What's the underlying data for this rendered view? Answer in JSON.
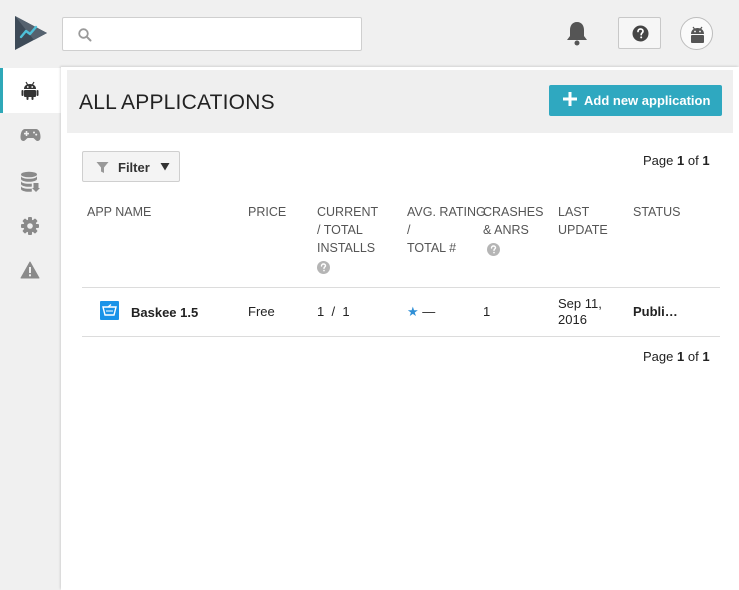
{
  "search": {
    "placeholder": "",
    "value": ""
  },
  "sidebar": {
    "items": [
      {
        "icon": "android-icon",
        "active": true
      },
      {
        "icon": "gamepad-icon",
        "active": false
      },
      {
        "icon": "database-icon",
        "active": false
      },
      {
        "icon": "gear-icon",
        "active": false
      },
      {
        "icon": "warning-icon",
        "active": false
      }
    ]
  },
  "header": {
    "title": "ALL APPLICATIONS",
    "add_button_label": "Add new application"
  },
  "filter": {
    "label": "Filter"
  },
  "pager": {
    "prefix": "Page",
    "current": "1",
    "of": "of",
    "total": "1"
  },
  "table": {
    "columns": [
      {
        "line1": "APP NAME",
        "line2": "",
        "line3": "",
        "help": false
      },
      {
        "line1": "PRICE",
        "line2": "",
        "line3": "",
        "help": false
      },
      {
        "line1": "CURRENT",
        "line2": "/ TOTAL",
        "line3": "INSTALLS",
        "help": true
      },
      {
        "line1": "AVG. RATING",
        "line2": "/",
        "line3": "TOTAL #",
        "help": false
      },
      {
        "line1": "CRASHES",
        "line2": "& ANRS",
        "line3": "",
        "help": true
      },
      {
        "line1": "LAST",
        "line2": "UPDATE",
        "line3": "",
        "help": false
      },
      {
        "line1": "STATUS",
        "line2": "",
        "line3": "",
        "help": false
      }
    ],
    "rows": [
      {
        "app_name": "Baskee 1.5",
        "price": "Free",
        "current_installs": "1",
        "installs_sep": "/",
        "total_installs": "1",
        "rating_star": "★",
        "rating_value": "—",
        "crashes": "1",
        "last_update_line1": "Sep 11,",
        "last_update_line2": "2016",
        "status": "Publi…"
      }
    ]
  },
  "colors": {
    "accent": "#2fa8c0",
    "active_bar": "#2ea8b8",
    "app_icon": "#1a93e8",
    "star": "#2f8fd6"
  }
}
